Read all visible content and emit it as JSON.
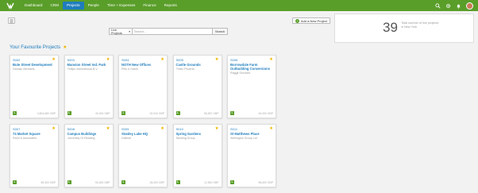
{
  "nav": {
    "items": [
      {
        "label": "Dashboard",
        "active": false,
        "caret": false
      },
      {
        "label": "CRM",
        "active": false,
        "caret": false
      },
      {
        "label": "Projects",
        "active": true,
        "caret": false
      },
      {
        "label": "People",
        "active": false,
        "caret": false
      },
      {
        "label": "Time + Expenses",
        "active": false,
        "caret": false
      },
      {
        "label": "Finance",
        "active": false,
        "caret": false
      },
      {
        "label": "Reports",
        "active": false,
        "caret": false
      }
    ],
    "icons": [
      "search-icon",
      "gear-icon",
      "bell-icon",
      "avatar"
    ]
  },
  "toolbar": {
    "add_project_label": "Add a New Project"
  },
  "search": {
    "filter_value": "Live Projects",
    "placeholder": "Search...",
    "button_label": "Search"
  },
  "section": {
    "title": "Your Favourite Projects"
  },
  "projects": [
    {
      "code": "S002",
      "name": "Bute Street Development",
      "client": "Damian Michaels",
      "value": "3,804,680 GBP"
    },
    {
      "code": "S003",
      "name": "Mansion Street Ind. Park",
      "client": "Philips International B.V.",
      "value": "40,000 GBP"
    },
    {
      "code": "S004",
      "name": "NOTH New Offices",
      "client": "Pitts & Harris",
      "value": "32,543 GBP"
    },
    {
      "code": "S005",
      "name": "Castle Grounds",
      "client": "Potter Phoenix",
      "value": "56,567 GBP"
    },
    {
      "code": "S006",
      "name": "Borrowdale Farm Outbuilding Conversions",
      "client": "Raggit Services",
      "value": "40,000 GBP"
    },
    {
      "code": "S007",
      "name": "74 Market Square",
      "client": "Rand & Associates",
      "value": "65,300 GBP"
    },
    {
      "code": "S008",
      "name": "Campus Buildings",
      "client": "University Of Reading",
      "value": "50,600 GBP"
    },
    {
      "code": "S009",
      "name": "Stanley Lake HQ",
      "client": "Dalbuilt",
      "value": "28,400 GBP"
    },
    {
      "code": "S010",
      "name": "Spring Gardens",
      "client": "Banding Group",
      "value": "12,800 GBP"
    },
    {
      "code": "S011",
      "name": "St Matthews Place",
      "client": "Wellington Group Ltd",
      "value": "56,600 GBP"
    }
  ],
  "stats": {
    "number": "39",
    "label": "Total number of live projects in New York"
  },
  "colors": {
    "nav_bg": "#5a9e2a",
    "active_tab": "#1f7dbd",
    "link": "#1f7dbd",
    "star": "#f0b400",
    "badge": "#5a9e2a"
  }
}
